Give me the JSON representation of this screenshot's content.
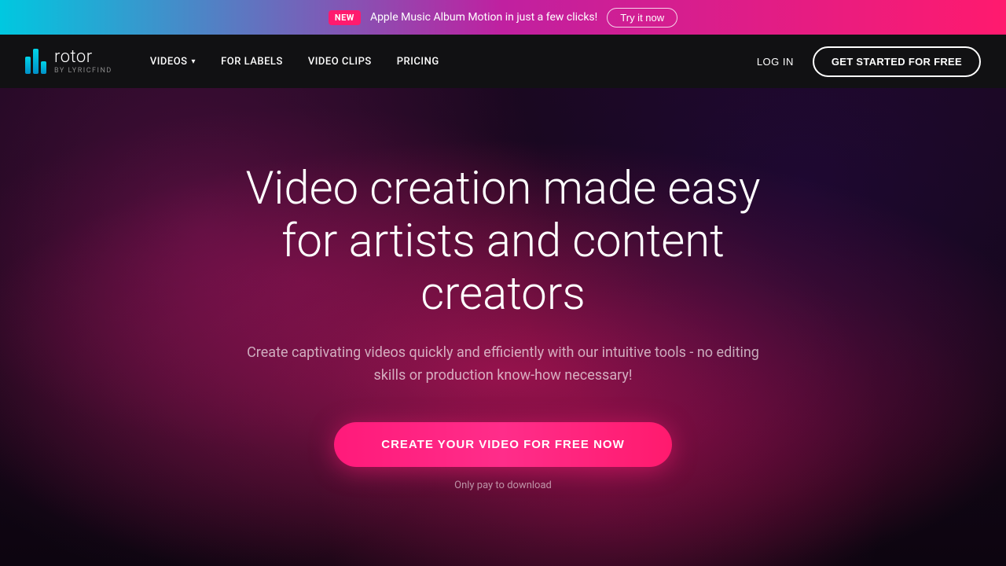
{
  "announcement": {
    "badge": "NEW",
    "text": "Apple Music Album Motion in just a few clicks!",
    "cta_label": "Try it now"
  },
  "navbar": {
    "logo_main": "rotor",
    "logo_sub": "BY LYRICFIND",
    "links": [
      {
        "id": "videos",
        "label": "VIDEOS",
        "has_dropdown": true
      },
      {
        "id": "for-labels",
        "label": "FOR LABELS",
        "has_dropdown": false
      },
      {
        "id": "video-clips",
        "label": "VIDEO CLIPS",
        "has_dropdown": false
      },
      {
        "id": "pricing",
        "label": "PRICING",
        "has_dropdown": false
      }
    ],
    "login_label": "LOG IN",
    "get_started_label": "GET STARTED FOR FREE"
  },
  "hero": {
    "title": "Video creation made easy for artists and content creators",
    "subtitle": "Create captivating videos quickly and efficiently with our intuitive tools - no editing skills or production know-how necessary!",
    "cta_label": "CREATE YOUR VIDEO FOR FREE NOW",
    "cta_note": "Only pay to download"
  }
}
